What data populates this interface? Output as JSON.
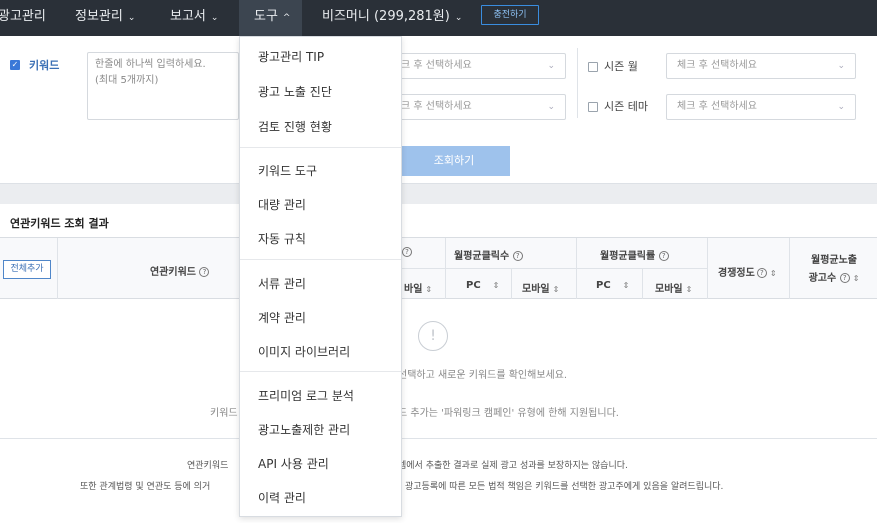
{
  "nav": {
    "items": [
      {
        "label": "광고관리",
        "chevron": false
      },
      {
        "label": "정보관리",
        "chevron": true
      },
      {
        "label": "보고서",
        "chevron": true
      },
      {
        "label": "도구",
        "chevron": true,
        "active": true
      },
      {
        "label": "비즈머니 (299,281원)",
        "chevron": true
      }
    ],
    "charge_label": "충전하기",
    "chevron_down": "⌄",
    "chevron_up": "^"
  },
  "panel": {
    "keyword_label": "키워드",
    "keyword_placeholder_line1": "한줄에 하나씩 입력하세요.",
    "keyword_placeholder_line2": "(최대 5개까지)",
    "select_placeholder": "체크 후 선택하세요",
    "select_placeholder_partial": "크 후 선택하세요",
    "season_month_label": "시즌 월",
    "season_theme_label": "시즌 테마",
    "search_button": "조회하기"
  },
  "results": {
    "title": "연관키워드 조회 결과",
    "add_all_button": "전체추가",
    "headers": {
      "keyword": "연관키워드",
      "clicks": "월평균클릭수",
      "ctr": "월평균클릭률",
      "competition": "경쟁정도",
      "ads_line1": "월평균노출",
      "ads_line2": "광고수",
      "mobile_partial": "바일",
      "pc": "PC",
      "mobile": "모바일"
    },
    "empty_icon": "!",
    "empty_message": "선택하고 새로운 키워드를 확인해보세요.",
    "empty_note_left": "키워드",
    "empty_note_right": "드 추가는 '파워링크 캠페인' 유형에 한해 지원됩니다."
  },
  "footer": {
    "line1_left": "연관키워드",
    "line1_right": "템에서 추출한 결과로 실제 광고 성과를 보장하지는 않습니다.",
    "line2_left": "또한 관계법령 및 연관도 등에 의거",
    "line2_right": "광고등록에 따른 모든 법적 책임은 키워드를 선택한 광고주에게 있음을 알려드립니다."
  },
  "tools_menu": {
    "groups": [
      [
        "광고관리 TIP",
        "광고 노출 진단",
        "검토 진행 현황"
      ],
      [
        "키워드 도구",
        "대량 관리",
        "자동 규칙"
      ],
      [
        "서류 관리",
        "계약 관리",
        "이미지 라이브러리"
      ],
      [
        "프리미엄 로그 분석",
        "광고노출제한 관리",
        "API 사용 관리",
        "이력 관리"
      ]
    ]
  },
  "colors": {
    "nav_bg": "#2a3038",
    "accent": "#3a78d8",
    "search_button": "#9ec2ec"
  }
}
